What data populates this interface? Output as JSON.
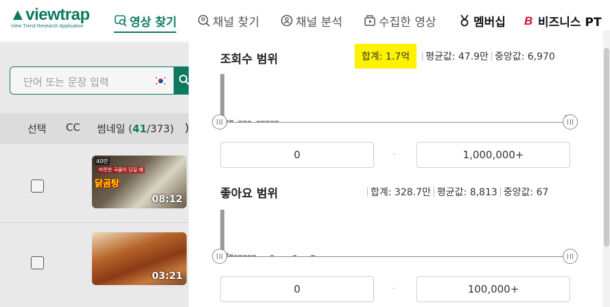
{
  "logo": {
    "name": "viewtrap",
    "tagline": "View Trend Research Application"
  },
  "nav": [
    {
      "label": "영상 찾기",
      "icon": "video-search-icon",
      "active": true
    },
    {
      "label": "채널 찾기",
      "icon": "channel-search-icon"
    },
    {
      "label": "채널 분석",
      "icon": "channel-analysis-icon"
    },
    {
      "label": "수집한 영상",
      "icon": "collection-icon"
    },
    {
      "label": "멤버십",
      "icon": "medal-icon"
    },
    {
      "label": "비즈니스 PT",
      "icon": "business-b-icon"
    }
  ],
  "search": {
    "placeholder": "단어 또는 문장 입력",
    "flag_icon": "korea-flag-icon"
  },
  "table": {
    "headers": {
      "select": "선택",
      "cc": "CC",
      "thumbnail": "썸네일",
      "count_shown": "41",
      "count_total": "/373)",
      "open_paren": " ("
    },
    "rows": [
      {
        "duration": "08:12",
        "badge": "40만",
        "caption": "따뜻한 국물이 당길 때",
        "tag": "닭곰탕"
      },
      {
        "duration": "03:21"
      }
    ]
  },
  "views": {
    "title": "조회수 범위",
    "total": "합계: 1.7억",
    "avg": "평균값: 47.9만",
    "median": "중앙값: 6,970",
    "min": "0",
    "max": "1,000,000+",
    "hist": [
      1.0,
      0.05,
      0.05,
      0.0,
      0.02,
      0.02,
      0.02,
      0.0,
      0.02,
      0.02,
      0.02,
      0.02,
      0.02,
      0.0,
      0.0,
      0.0,
      0.0,
      0.0,
      0.0,
      0.0,
      0.0,
      0.0,
      0.0,
      0.0,
      0.0,
      0.0,
      0.0,
      0.0,
      0.0,
      0.0,
      0.0,
      0.0,
      0.0,
      0.0,
      0.0,
      0.0,
      0.0,
      0.0,
      0.0,
      0.0,
      0.0,
      0.0,
      0.0,
      0.0,
      0.0,
      0.0,
      0.0,
      0.0,
      0.0,
      0.0,
      0.0,
      0.0,
      0.0,
      0.0,
      0.0,
      0.0,
      0.0,
      0.0,
      0.0,
      0.0,
      0.0,
      0.0,
      0.0,
      0.0,
      0.0,
      0.0,
      0.0,
      0.0,
      0.0,
      0.0,
      0.0,
      0.0,
      0.0,
      0.0,
      0.0,
      0.0,
      0.15
    ]
  },
  "likes": {
    "title": "좋아요 범위",
    "total": "합계: 328.7만",
    "avg": "평균값: 8,813",
    "median": "중앙값: 67",
    "min": "0",
    "max": "100,000+",
    "hist": [
      1.0,
      0.08,
      0.05,
      0.02,
      0.02,
      0.02,
      0.02,
      0.02,
      0.0,
      0.0,
      0.0,
      0.02,
      0.0,
      0.0,
      0.0,
      0.0,
      0.02,
      0.0,
      0.0,
      0.0,
      0.02,
      0.0,
      0.0,
      0.0,
      0.0,
      0.0,
      0.0,
      0.0,
      0.0,
      0.0,
      0.0,
      0.0,
      0.0,
      0.0,
      0.0,
      0.0,
      0.0,
      0.0,
      0.0,
      0.0,
      0.0,
      0.0,
      0.0,
      0.0,
      0.0,
      0.0,
      0.0,
      0.0,
      0.0,
      0.0,
      0.0,
      0.0,
      0.0,
      0.0,
      0.0,
      0.0,
      0.0,
      0.0,
      0.0,
      0.0,
      0.0,
      0.0,
      0.0,
      0.0,
      0.0,
      0.0,
      0.0,
      0.0,
      0.0,
      0.0,
      0.0,
      0.0,
      0.0,
      0.0,
      0.0,
      0.0,
      0.0
    ]
  },
  "colors": {
    "accent": "#0d7a5f",
    "highlight": "#fff200",
    "business": "#c8102e"
  }
}
